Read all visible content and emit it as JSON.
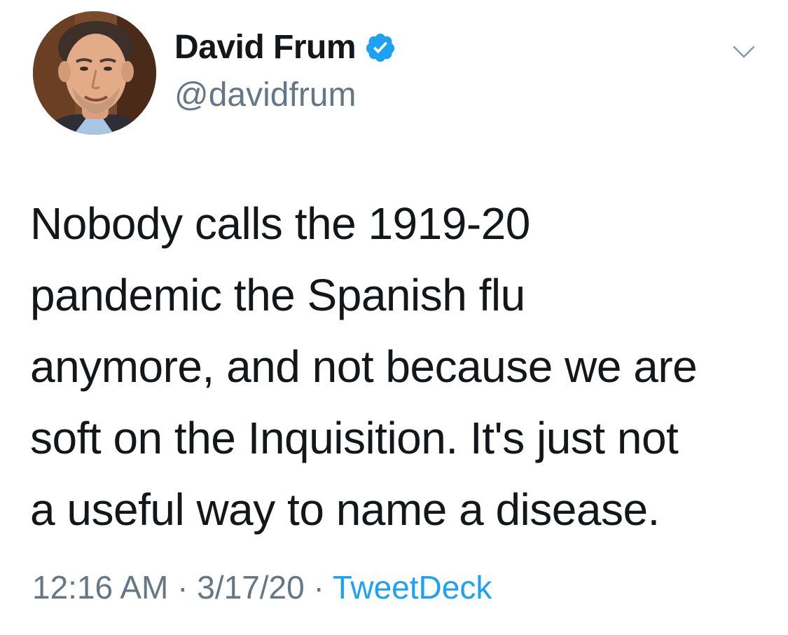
{
  "author": {
    "display_name": "David Frum",
    "handle": "@davidfrum",
    "verified": true,
    "verified_color": "#1da1f2"
  },
  "icons": {
    "verified": "verified-badge-icon",
    "more": "chevron-down-icon",
    "avatar": "profile-photo"
  },
  "tweet": {
    "lines": [
      "Nobody calls the 1919-20",
      "pandemic the Spanish flu",
      "anymore, and not because we are",
      "soft on the Inquisition. It's just not",
      "a useful way to name a disease."
    ]
  },
  "meta": {
    "time": "12:16 AM",
    "separator": " · ",
    "date": "3/17/20",
    "source": "TweetDeck"
  },
  "colors": {
    "text": "#14171a",
    "secondary": "#657786",
    "link": "#1da1f2"
  }
}
